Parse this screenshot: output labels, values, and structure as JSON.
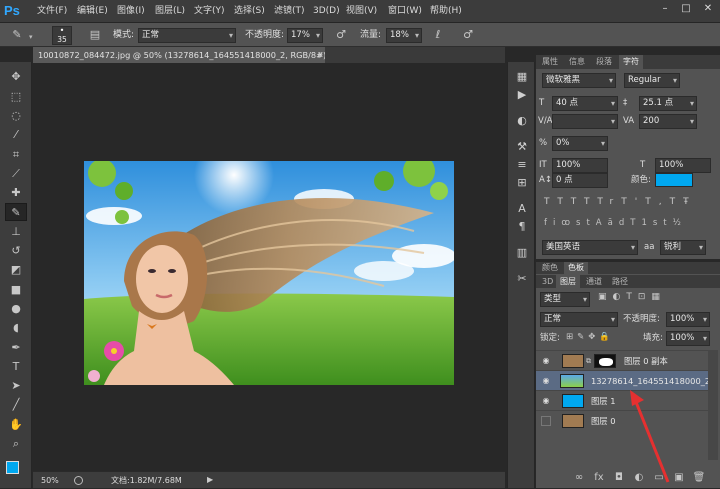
{
  "app": {
    "logo": "Ps"
  },
  "menubar": {
    "items": [
      "文件(F)",
      "编辑(E)",
      "图像(I)",
      "图层(L)",
      "文字(Y)",
      "选择(S)",
      "滤镜(T)",
      "3D(D)",
      "视图(V)",
      "窗口(W)",
      "帮助(H)"
    ],
    "window_buttons": [
      "–",
      "□",
      "✕"
    ]
  },
  "options": {
    "brush_size": "35",
    "mode_label": "模式:",
    "mode_value": "正常",
    "opacity_label": "不透明度:",
    "opacity_value": "17%",
    "flow_label": "流量:",
    "flow_value": "18%"
  },
  "document": {
    "tab_title": "10010872_084472.jpg @ 50% (13278614_164551418000_2, RGB/8#) *",
    "close_glyph": "×"
  },
  "status": {
    "zoom": "50%",
    "doc_info": "文档:1.82M/7.68M"
  },
  "char_panel": {
    "tabs": [
      "属性",
      "信息",
      "段落",
      "字符"
    ],
    "font_family": "微软雅黑",
    "font_style": "Regular",
    "font_size": "40 点",
    "leading": "25.1 点",
    "kerning": "",
    "tracking": "200",
    "scale_pct": "0%",
    "vscale": "100%",
    "hscale": "100%",
    "baseline": "0 点",
    "color_label": "颜色:",
    "type_buttons": [
      "T",
      "T",
      "TT",
      "Tr",
      "T'",
      "T,",
      "T",
      "Ŧ"
    ],
    "ot_buttons": [
      "fi",
      "ꝏ",
      "st",
      "A",
      "ād",
      "T",
      "1st",
      "½"
    ],
    "language": "美国英语",
    "aa_label": "aa",
    "antialias": "锐利",
    "text_color": "#00a8f0"
  },
  "layers_panel": {
    "top_tabs": [
      "颜色",
      "色板"
    ],
    "tabs": [
      "3D",
      "图层",
      "通道",
      "路径"
    ],
    "filter_value": "类型",
    "blend_mode": "正常",
    "opacity_label": "不透明度:",
    "opacity_value": "100%",
    "lock_label": "锁定:",
    "fill_label": "填充:",
    "fill_value": "100%",
    "layers": [
      {
        "name": "图层 0 副本",
        "visible": true,
        "selected": false
      },
      {
        "name": "13278614_164551418000_2",
        "visible": true,
        "selected": true
      },
      {
        "name": "图层 1",
        "visible": true,
        "selected": false
      },
      {
        "name": "图层 0",
        "visible": false,
        "selected": false
      }
    ],
    "bottom_buttons": [
      "∞",
      "fx",
      "◘",
      "◐",
      "▭",
      "▣",
      "🗑"
    ]
  },
  "colors": {
    "foreground": "#00a8f0",
    "background": "#f07a1a",
    "selection_arrow": "#e53030"
  }
}
